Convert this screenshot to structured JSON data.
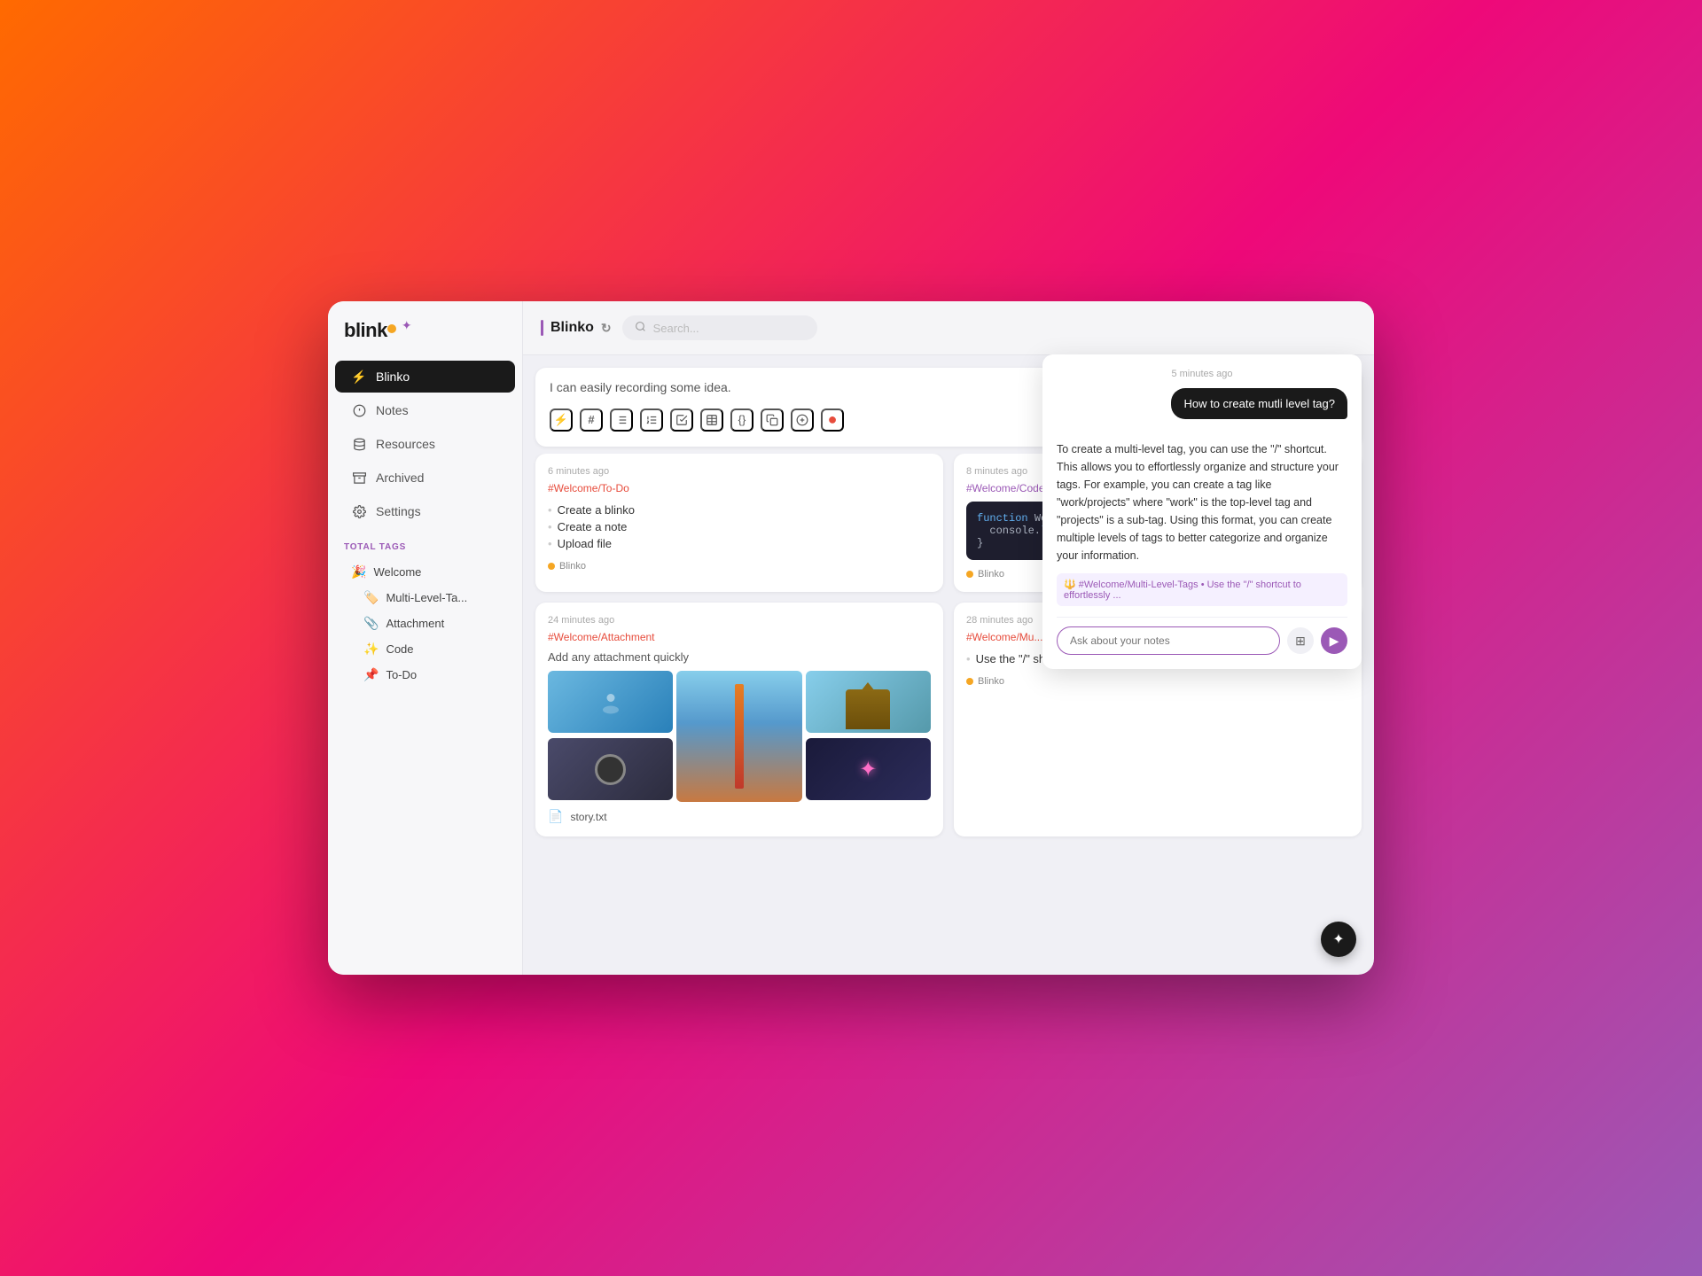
{
  "app": {
    "name": "Blinko",
    "window_title": "Blinko"
  },
  "sidebar": {
    "logo": "blinko",
    "nav_items": [
      {
        "id": "blinko",
        "label": "Blinko",
        "icon": "⚡",
        "active": true
      },
      {
        "id": "notes",
        "label": "Notes",
        "icon": "📝",
        "active": false
      },
      {
        "id": "resources",
        "label": "Resources",
        "icon": "🗂️",
        "active": false
      },
      {
        "id": "archived",
        "label": "Archived",
        "icon": "📦",
        "active": false
      },
      {
        "id": "settings",
        "label": "Settings",
        "icon": "⚙️",
        "active": false
      }
    ],
    "tags_label": "TOTAL TAGS",
    "tags": [
      {
        "emoji": "🎉",
        "label": "Welcome",
        "indent": 0
      },
      {
        "emoji": "🏷️",
        "label": "Multi-Level-Ta...",
        "indent": 1
      },
      {
        "emoji": "📎",
        "label": "Attachment",
        "indent": 1
      },
      {
        "emoji": "✨",
        "label": "Code",
        "indent": 1
      },
      {
        "emoji": "📌",
        "label": "To-Do",
        "indent": 1
      }
    ]
  },
  "topbar": {
    "title": "Blinko",
    "search_placeholder": "Search..."
  },
  "input_area": {
    "placeholder": "I can easily recording some idea.",
    "toolbar_items": [
      "⚡",
      "#",
      "≡",
      "≡",
      "✗",
      "⊞",
      "{}",
      "□",
      "⊕",
      "●"
    ],
    "send_label": "▶"
  },
  "notes": [
    {
      "id": "todo",
      "time": "6 minutes ago",
      "tag": "#Welcome/To-Do",
      "tag_color": "red",
      "items": [
        "Create a blinko",
        "Create a note",
        "Upload file"
      ],
      "author": "Blinko"
    },
    {
      "id": "code",
      "time": "8 minutes ago",
      "tag": "#Welcome/Code",
      "tag_color": "purple",
      "code": "function Welcome(){\n  console.log(\"Hello! Blinko\");\n}",
      "author": "Blinko"
    },
    {
      "id": "attachment",
      "time": "24 minutes ago",
      "tag": "#Welcome/Attachment",
      "tag_color": "red",
      "title": "Add any attachment quickly",
      "file": "story.txt",
      "author": "Blinko"
    },
    {
      "id": "multilevel",
      "time": "28 minutes ago",
      "tag": "#Welcome/Mu...",
      "tag_color": "red",
      "text": "Use the \"/\" shortcut to create multi-level tags.",
      "author": "Blinko"
    }
  ],
  "ai_chat": {
    "time": "5 minutes ago",
    "user_message": "How to create mutli level tag?",
    "ai_response": "To create a multi-level tag, you can use the \"/\" shortcut. This allows you to effortlessly organize and structure your tags. For example, you can create a tag like \"work/projects\" where \"work\" is the top-level tag and \"projects\" is a sub-tag. Using this format, you can create multiple levels of tags to better categorize and organize your information.",
    "source": "🔱 #Welcome/Multi-Level-Tags • Use the \"/\" shortcut to effortlessly ...",
    "input_placeholder": "Ask about your notes",
    "gallery_icon": "⊞",
    "send_icon": "▶",
    "float_icon": "✦"
  }
}
